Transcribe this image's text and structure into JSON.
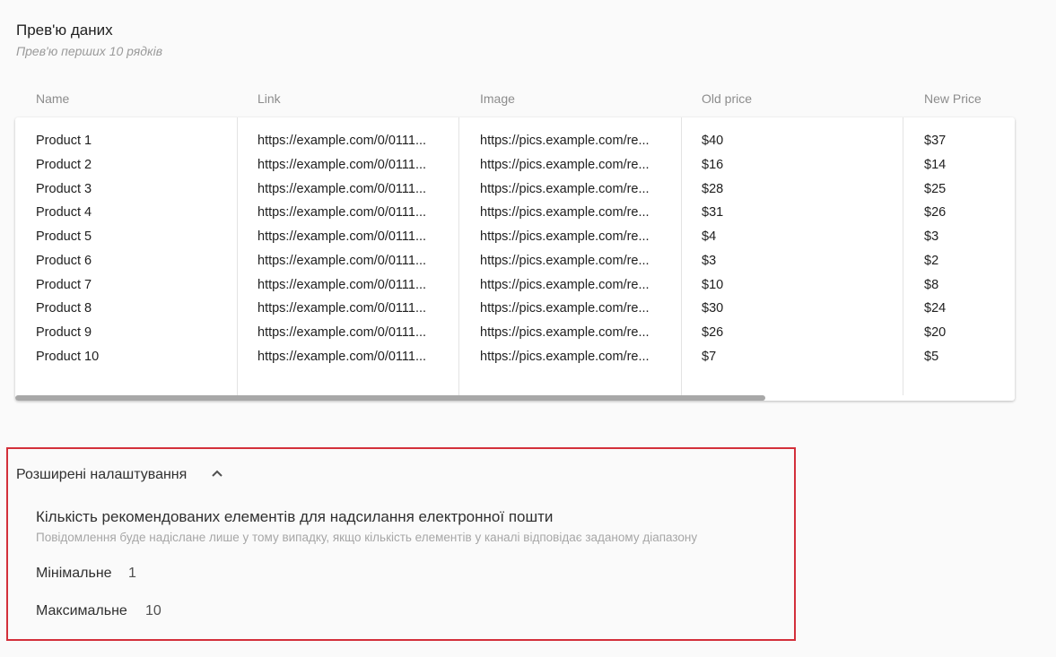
{
  "preview": {
    "title": "Прев'ю даних",
    "subtitle": "Прев'ю перших 10 рядків"
  },
  "table": {
    "columns": [
      "Name",
      "Link",
      "Image",
      "Old price",
      "New Price"
    ],
    "rows": [
      [
        "Product 1",
        "https://example.com/0/0111...",
        "https://pics.example.com/re...",
        "$40",
        "$37"
      ],
      [
        "Product 2",
        "https://example.com/0/0111...",
        "https://pics.example.com/re...",
        "$16",
        "$14"
      ],
      [
        "Product 3",
        "https://example.com/0/0111...",
        "https://pics.example.com/re...",
        "$28",
        "$25"
      ],
      [
        "Product 4",
        "https://example.com/0/0111...",
        "https://pics.example.com/re...",
        "$31",
        "$26"
      ],
      [
        "Product 5",
        "https://example.com/0/0111...",
        "https://pics.example.com/re...",
        "$4",
        "$3"
      ],
      [
        "Product 6",
        "https://example.com/0/0111...",
        "https://pics.example.com/re...",
        "$3",
        "$2"
      ],
      [
        "Product 7",
        "https://example.com/0/0111...",
        "https://pics.example.com/re...",
        "$10",
        "$8"
      ],
      [
        "Product 8",
        "https://example.com/0/0111...",
        "https://pics.example.com/re...",
        "$30",
        "$24"
      ],
      [
        "Product 9",
        "https://example.com/0/0111...",
        "https://pics.example.com/re...",
        "$26",
        "$20"
      ],
      [
        "Product 10",
        "https://example.com/0/0111...",
        "https://pics.example.com/re...",
        "$7",
        "$5"
      ]
    ]
  },
  "advanced": {
    "title": "Розширені налаштування",
    "toggle_icon": "chevron-up-icon",
    "setting_title": "Кількість рекомендованих елементів для надсилання електронної пошти",
    "setting_description": "Повідомлення буде надіслане лише у тому випадку, якщо кількість елементів у каналі відповідає заданому діапазону",
    "min_label": "Мінімальне",
    "min_value": "1",
    "max_label": "Максимальне",
    "max_value": "10"
  },
  "colors": {
    "highlight_border": "#d32f3a",
    "scrollbar": "#a8a8a8"
  }
}
